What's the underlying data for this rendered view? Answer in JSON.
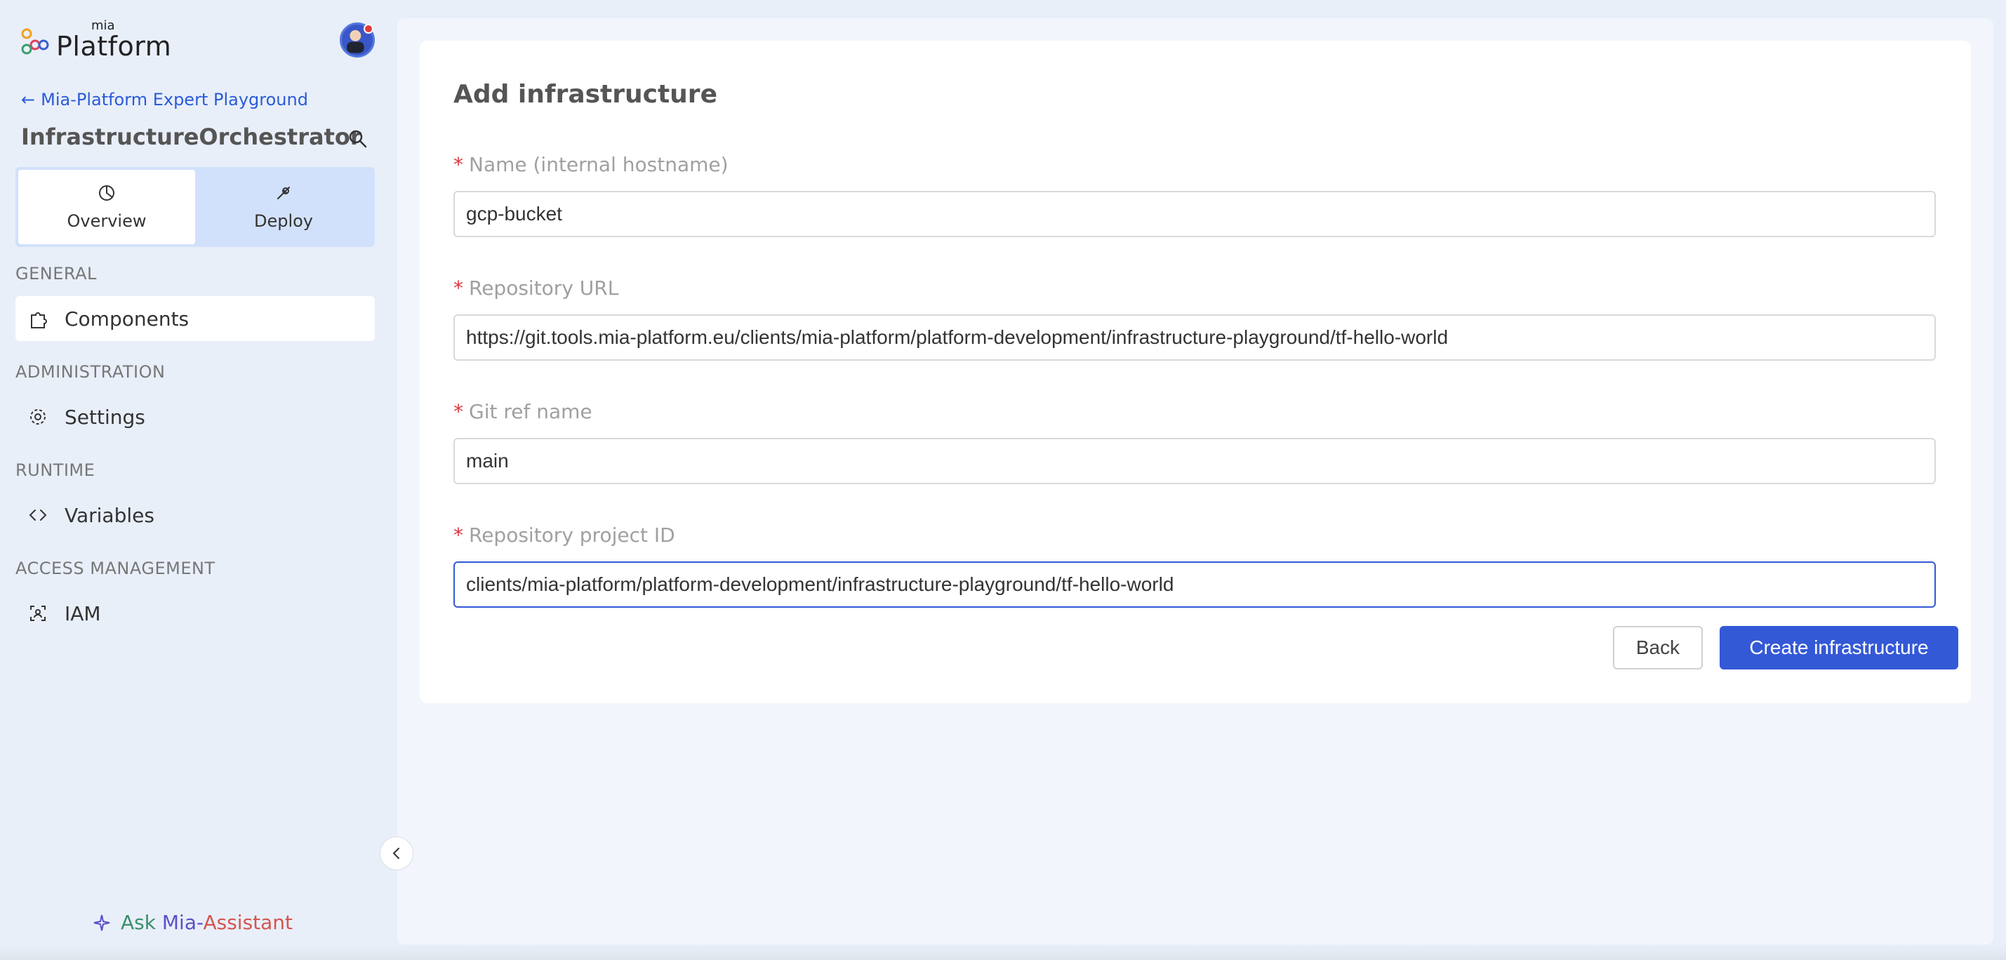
{
  "brand": {
    "small": "mia",
    "big": "Platform"
  },
  "sidebar": {
    "back_link": "Mia-Platform Expert Playground",
    "app_title": "InfrastructureOrchestrator",
    "switcher": [
      {
        "label": "Overview",
        "icon": "pie-chart-icon",
        "active": true
      },
      {
        "label": "Deploy",
        "icon": "rocket-icon",
        "active": false
      }
    ],
    "sections": [
      {
        "label": "GENERAL",
        "items": [
          {
            "label": "Components",
            "icon": "puzzle-icon",
            "active": true
          }
        ]
      },
      {
        "label": "ADMINISTRATION",
        "items": [
          {
            "label": "Settings",
            "icon": "gear-icon",
            "active": false
          }
        ]
      },
      {
        "label": "RUNTIME",
        "items": [
          {
            "label": "Variables",
            "icon": "code-icon",
            "active": false
          }
        ]
      },
      {
        "label": "ACCESS MANAGEMENT",
        "items": [
          {
            "label": "IAM",
            "icon": "user-scan-icon",
            "active": false
          }
        ]
      }
    ],
    "assistant": {
      "ask": "Ask",
      "mia": "Mia-",
      "assistant": "Assistant"
    }
  },
  "form": {
    "title": "Add infrastructure",
    "required_mark": "*",
    "fields": [
      {
        "label": "Name (internal hostname)",
        "value": "gcp-bucket"
      },
      {
        "label": "Repository URL",
        "value": "https://git.tools.mia-platform.eu/clients/mia-platform/platform-development/infrastructure-playground/tf-hello-world"
      },
      {
        "label": "Git ref name",
        "value": "main"
      },
      {
        "label": "Repository project ID",
        "value": "clients/mia-platform/platform-development/infrastructure-playground/tf-hello-world"
      }
    ],
    "back_label": "Back",
    "create_label": "Create infrastructure"
  },
  "colors": {
    "accent": "#3459d6",
    "required": "#d9363e",
    "sidebar_bg": "#e9eff9"
  }
}
